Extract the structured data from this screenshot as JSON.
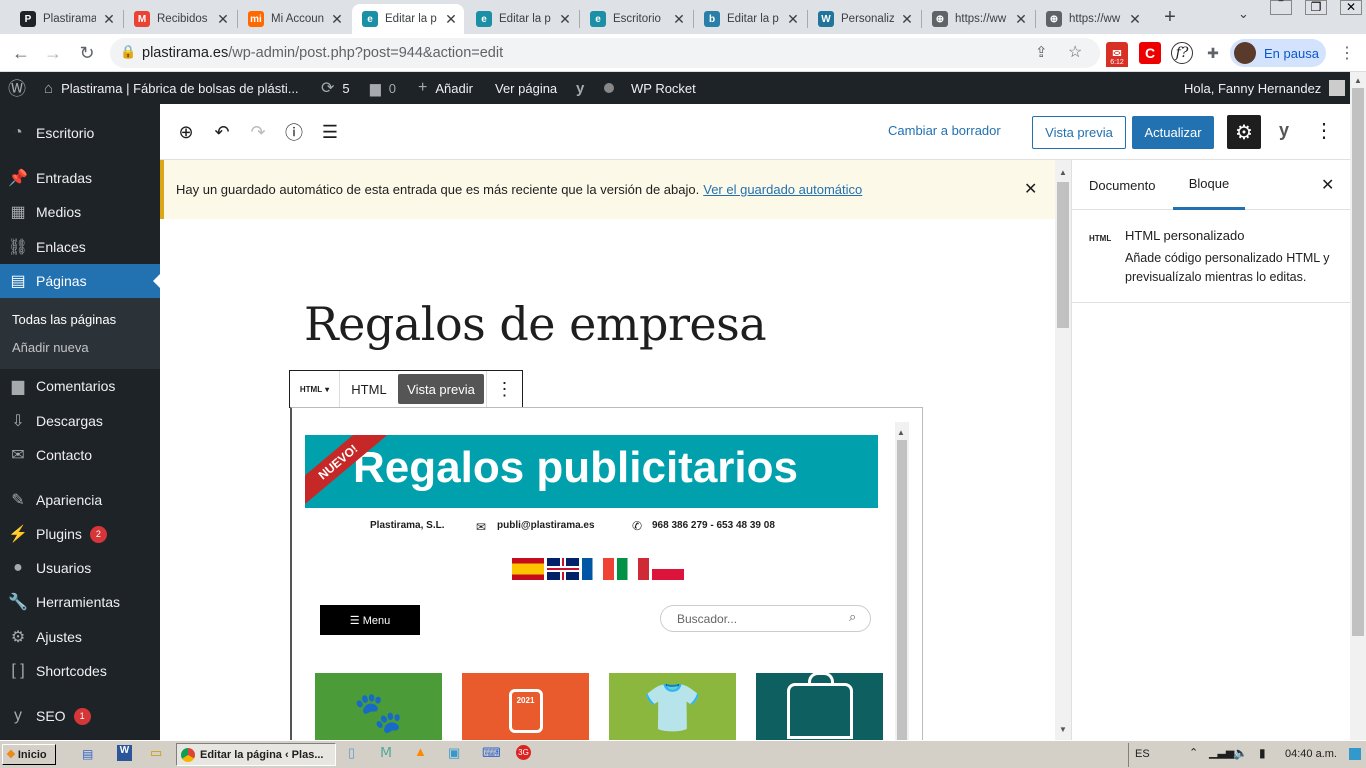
{
  "browser": {
    "tabs": [
      {
        "label": "Plastirama",
        "icon": "P",
        "color": "#1d2327",
        "active": false
      },
      {
        "label": "Recibidos",
        "icon": "M",
        "color": "#ea4335",
        "active": false
      },
      {
        "label": "Mi Account",
        "icon": "mi",
        "color": "#ff6900",
        "active": false
      },
      {
        "label": "Editar la p",
        "icon": "e",
        "color": "#1a8fa5",
        "active": true
      },
      {
        "label": "Editar la p",
        "icon": "e",
        "color": "#1a8fa5",
        "active": false
      },
      {
        "label": "Escritorio",
        "icon": "e",
        "color": "#1a8fa5",
        "active": false
      },
      {
        "label": "Editar la p",
        "icon": "b",
        "color": "#2a7fa8",
        "active": false
      },
      {
        "label": "Personaliz",
        "icon": "W",
        "color": "#21759b",
        "active": false
      },
      {
        "label": "https://ww",
        "icon": "⊕",
        "color": "#5f6368",
        "active": false
      },
      {
        "label": "https://ww",
        "icon": "⊕",
        "color": "#5f6368",
        "active": false
      }
    ],
    "new_tab": "+",
    "url_host": "plastirama.es",
    "url_path": "/wp-admin/post.php?post=944&action=edit",
    "mail_badge": "6:12",
    "profile_status": "En pausa"
  },
  "adminbar": {
    "site_name": "Plastirama | Fábrica de bolsas de plásti...",
    "updates": "5",
    "comments": "0",
    "add_new": "Añadir",
    "view_page": "Ver página",
    "rocket": "WP Rocket",
    "greeting": "Hola, Fanny Hernandez"
  },
  "sidebar": {
    "items": [
      {
        "label": "Escritorio",
        "icon": "dashboard-icon"
      },
      {
        "label": "Entradas",
        "icon": "pin-icon"
      },
      {
        "label": "Medios",
        "icon": "media-icon"
      },
      {
        "label": "Enlaces",
        "icon": "link-icon"
      },
      {
        "label": "Páginas",
        "icon": "pages-icon"
      },
      {
        "label": "Comentarios",
        "icon": "comment-icon"
      },
      {
        "label": "Descargas",
        "icon": "download-icon"
      },
      {
        "label": "Contacto",
        "icon": "mail-icon"
      },
      {
        "label": "Apariencia",
        "icon": "brush-icon"
      },
      {
        "label": "Plugins",
        "icon": "plugin-icon",
        "badge": "2"
      },
      {
        "label": "Usuarios",
        "icon": "user-icon"
      },
      {
        "label": "Herramientas",
        "icon": "wrench-icon"
      },
      {
        "label": "Ajustes",
        "icon": "settings-icon"
      },
      {
        "label": "Shortcodes",
        "icon": "brackets-icon"
      },
      {
        "label": "SEO",
        "icon": "yoast-icon",
        "badge": "1"
      }
    ],
    "sub_all_pages": "Todas las páginas",
    "sub_add_new": "Añadir nueva"
  },
  "editor": {
    "switch_draft": "Cambiar a borrador",
    "preview": "Vista previa",
    "update": "Actualizar",
    "notice_text": "Hay un guardado automático de esta entrada que es más reciente que la versión de abajo.",
    "notice_link": "Ver el guardado automático",
    "page_title": "Regalos de empresa",
    "block_type": "HTML",
    "tab_html": "HTML",
    "tab_preview": "Vista previa"
  },
  "preview_site": {
    "ribbon": "NUEVO!",
    "banner": "Regalos publicitarios",
    "company": "Plastirama, S.L.",
    "email": "publi@plastirama.es",
    "phone": "968 386 279 - 653 48 39 08",
    "menu": "☰ Menu",
    "search_placeholder": "Buscador...",
    "year_tile": "2021"
  },
  "panel": {
    "tab_document": "Documento",
    "tab_block": "Bloque",
    "block_icon": "HTML",
    "block_name": "HTML personalizado",
    "block_desc": "Añade código personalizado HTML y previsualízalo mientras lo editas."
  },
  "taskbar": {
    "start": "Inicio",
    "task": "Editar la página ‹ Plas...",
    "lang": "ES",
    "clock": "04:40 a.m."
  }
}
